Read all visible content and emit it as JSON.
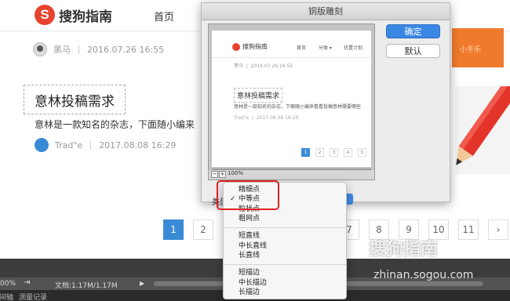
{
  "site": {
    "logo_mark": "S",
    "logo_text": "搜狗指南",
    "nav_home": "首页",
    "author": "黑马",
    "date": "2016.07.26 16:55",
    "title": "意林投稿需求",
    "description": "意林是一款知名的杂志，下面随小编来",
    "trade_name": "Trad\"e",
    "trade_date": "2017.08.08 16:29",
    "banner_text": "小手乐",
    "pagination": [
      "1",
      "2",
      "7",
      "8",
      "9",
      "10",
      "11",
      "›"
    ]
  },
  "dialog": {
    "title": "铜版雕刻",
    "ok_label": "确定",
    "default_label": "默认",
    "type_label": "类型",
    "preview": {
      "logo_text": "搜狗指南",
      "nav": [
        "首页",
        "分类 ▾",
        "优置计划"
      ],
      "author": "黑马",
      "date": "2016.07.26 16:55",
      "title": "意林投稿需求",
      "desc": "意林是一款知名的杂志，下面随小编来看看投稿意林需要哪些",
      "trade": "Trad\"e",
      "trade_date": "2017.08.08 16:29",
      "pages": [
        "1",
        "2",
        "3",
        "4",
        "5"
      ],
      "zoom_minus": "−",
      "zoom_plus": "+",
      "zoom_value": "100%"
    }
  },
  "menu": {
    "items": [
      {
        "label": "精细点",
        "checked": false
      },
      {
        "label": "中等点",
        "checked": true
      },
      {
        "label": "粒状点",
        "checked": false
      },
      {
        "label": "粗网点",
        "checked": false
      },
      {
        "label": "短直线",
        "checked": false
      },
      {
        "label": "中长直线",
        "checked": false
      },
      {
        "label": "长直线",
        "checked": false
      },
      {
        "label": "短描边",
        "checked": false
      },
      {
        "label": "中长描边",
        "checked": false
      },
      {
        "label": "长描边",
        "checked": false
      }
    ],
    "check_mark": "✓"
  },
  "statusbar": {
    "zoom": "00%",
    "export_icon": "⇥",
    "doc_info": "文档:1.17M/1.17M",
    "arrow": "▶",
    "tab1": "时间轴",
    "tab2": "测量记录"
  },
  "watermark": {
    "text": "搜狗指南",
    "url": "zhinan.sogou.com"
  },
  "colors": {
    "accent": "#3b87e4",
    "brand": "#e8432e",
    "highlight": "#e02020"
  }
}
